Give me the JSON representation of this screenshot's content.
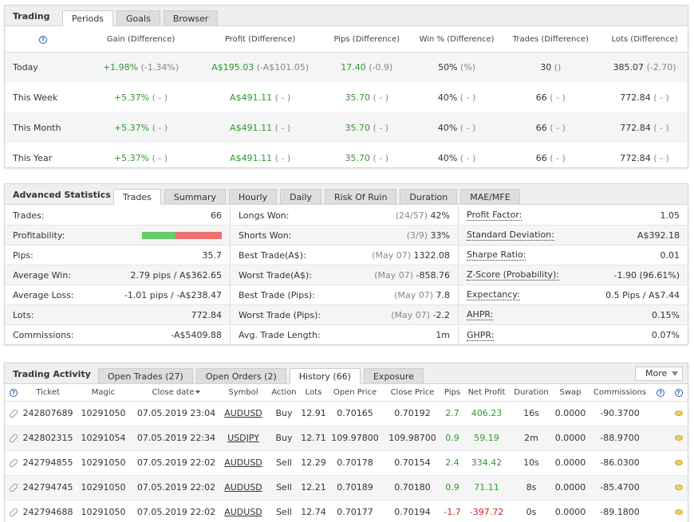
{
  "trading": {
    "title": "Trading",
    "tabs": [
      "Periods",
      "Goals",
      "Browser"
    ],
    "active_tab": 0,
    "help": "?",
    "headers": [
      "Gain (Difference)",
      "Profit (Difference)",
      "Pips (Difference)",
      "Win % (Difference)",
      "Trades (Difference)",
      "Lots (Difference)"
    ],
    "rows": [
      {
        "label": "Today",
        "gain": "+1.98%",
        "gain_diff": "(-1.34%)",
        "profit": "A$195.03",
        "profit_diff": "(-A$101.05)",
        "pips": "17.40",
        "pips_diff": "(-0.9)",
        "win": "50%",
        "win_diff": "(%)",
        "trades": "30",
        "trades_diff": "()",
        "lots": "385.07",
        "lots_diff": "(-2.70)"
      },
      {
        "label": "This Week",
        "gain": "+5.37%",
        "gain_diff": "( - )",
        "profit": "A$491.11",
        "profit_diff": "( - )",
        "pips": "35.70",
        "pips_diff": "( - )",
        "win": "40%",
        "win_diff": "( - )",
        "trades": "66",
        "trades_diff": "( - )",
        "lots": "772.84",
        "lots_diff": "( - )"
      },
      {
        "label": "This Month",
        "gain": "+5.37%",
        "gain_diff": "( - )",
        "profit": "A$491.11",
        "profit_diff": "( - )",
        "pips": "35.70",
        "pips_diff": "( - )",
        "win": "40%",
        "win_diff": "( - )",
        "trades": "66",
        "trades_diff": "( - )",
        "lots": "772.84",
        "lots_diff": "( - )"
      },
      {
        "label": "This Year",
        "gain": "+5.37%",
        "gain_diff": "( - )",
        "profit": "A$491.11",
        "profit_diff": "( - )",
        "pips": "35.70",
        "pips_diff": "( - )",
        "win": "40%",
        "win_diff": "( - )",
        "trades": "66",
        "trades_diff": "( - )",
        "lots": "772.84",
        "lots_diff": "( - )"
      }
    ]
  },
  "advanced": {
    "title": "Advanced Statistics",
    "tabs": [
      "Trades",
      "Summary",
      "Hourly",
      "Daily",
      "Risk Of Ruin",
      "Duration",
      "MAE/MFE"
    ],
    "active_tab": 0,
    "profitability_win_fraction": 0.42,
    "col1": [
      {
        "k": "Trades:",
        "v": "66"
      },
      {
        "k": "Profitability:",
        "v": ""
      },
      {
        "k": "Pips:",
        "v": "35.7"
      },
      {
        "k": "Average Win:",
        "v": "2.79 pips / A$362.65"
      },
      {
        "k": "Average Loss:",
        "v": "-1.01 pips / -A$238.47"
      },
      {
        "k": "Lots:",
        "v": "772.84"
      },
      {
        "k": "Commissions:",
        "v": "-A$5409.88"
      }
    ],
    "col2": [
      {
        "k": "Longs Won:",
        "note": "(24/57)",
        "v": "42%"
      },
      {
        "k": "Shorts Won:",
        "note": "(3/9)",
        "v": "33%"
      },
      {
        "k": "Best Trade(A$):",
        "note": "(May 07)",
        "v": "1322.08"
      },
      {
        "k": "Worst Trade(A$):",
        "note": "(May 07)",
        "v": "-858.76"
      },
      {
        "k": "Best Trade (Pips):",
        "note": "(May 07)",
        "v": "7.8"
      },
      {
        "k": "Worst Trade (Pips):",
        "note": "(May 07)",
        "v": "-2.2"
      },
      {
        "k": "Avg. Trade Length:",
        "note": "",
        "v": "1m"
      }
    ],
    "col3": [
      {
        "k": "Profit Factor:",
        "v": "1.05"
      },
      {
        "k": "Standard Deviation:",
        "v": "A$392.18"
      },
      {
        "k": "Sharpe Ratio:",
        "v": "0.01"
      },
      {
        "k": "Z-Score (Probability):",
        "v": "-1.90 (96.61%)"
      },
      {
        "k": "Expectancy:",
        "v": "0.5 Pips / A$7.44"
      },
      {
        "k": "AHPR:",
        "v": "0.15%"
      },
      {
        "k": "GHPR:",
        "v": "0.07%"
      }
    ]
  },
  "activity": {
    "title": "Trading Activity",
    "tabs": [
      "Open Trades (27)",
      "Open Orders (2)",
      "History (66)",
      "Exposure"
    ],
    "active_tab": 2,
    "more_label": "More",
    "help": "?",
    "headers": [
      "Ticket",
      "Magic",
      "Close date",
      "Symbol",
      "Action",
      "Lots",
      "Open Price",
      "Close Price",
      "Pips",
      "Net Profit",
      "Duration",
      "Swap",
      "Commissions"
    ],
    "rows": [
      {
        "ticket": "242807689",
        "magic": "10291050",
        "date": "07.05.2019 23:04",
        "symbol": "AUDUSD",
        "action": "Buy",
        "lots": "12.91",
        "open": "0.70165",
        "close": "0.70192",
        "pips": "2.7",
        "profit": "406.23",
        "duration": "16s",
        "swap": "0.0000",
        "comm": "-90.3700",
        "positive": true
      },
      {
        "ticket": "242802315",
        "magic": "10291054",
        "date": "07.05.2019 22:34",
        "symbol": "USDJPY",
        "action": "Buy",
        "lots": "12.71",
        "open": "109.97800",
        "close": "109.98700",
        "pips": "0.9",
        "profit": "59.19",
        "duration": "2m",
        "swap": "0.0000",
        "comm": "-88.9700",
        "positive": true
      },
      {
        "ticket": "242794855",
        "magic": "10291050",
        "date": "07.05.2019 22:02",
        "symbol": "AUDUSD",
        "action": "Sell",
        "lots": "12.29",
        "open": "0.70178",
        "close": "0.70154",
        "pips": "2.4",
        "profit": "334.42",
        "duration": "10s",
        "swap": "0.0000",
        "comm": "-86.0300",
        "positive": true
      },
      {
        "ticket": "242794745",
        "magic": "10291050",
        "date": "07.05.2019 22:02",
        "symbol": "AUDUSD",
        "action": "Sell",
        "lots": "12.21",
        "open": "0.70189",
        "close": "0.70180",
        "pips": "0.9",
        "profit": "71.11",
        "duration": "8s",
        "swap": "0.0000",
        "comm": "-85.4700",
        "positive": true
      },
      {
        "ticket": "242794688",
        "magic": "10291050",
        "date": "07.05.2019 22:02",
        "symbol": "AUDUSD",
        "action": "Sell",
        "lots": "12.74",
        "open": "0.70177",
        "close": "0.70194",
        "pips": "-1.7",
        "profit": "-397.72",
        "duration": "0s",
        "swap": "0.0000",
        "comm": "-89.1800",
        "positive": false
      }
    ]
  },
  "colors": {
    "positive": "#2e9a2e",
    "negative": "#d02020",
    "bar_win": "#66cc66",
    "bar_loss": "#f07070"
  }
}
